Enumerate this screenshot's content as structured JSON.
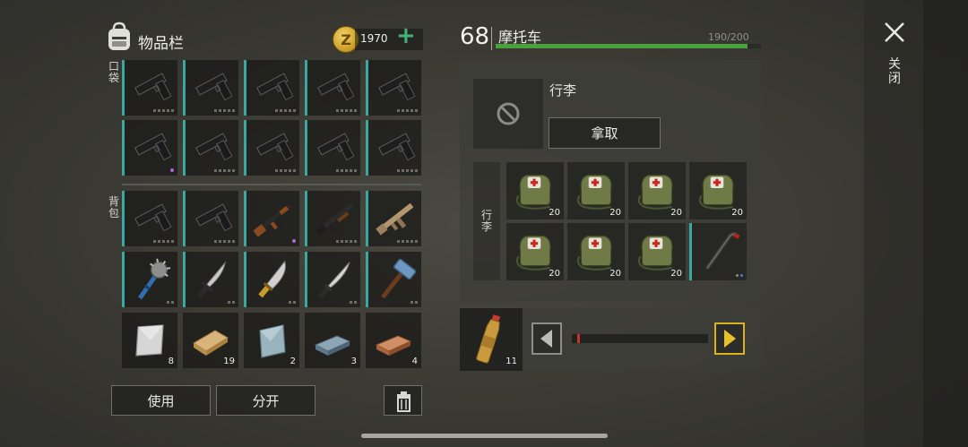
{
  "inventory": {
    "title": "物品栏",
    "coins": "1970",
    "coin_symbol": "Z",
    "pocket_label": "口袋",
    "backpack_label": "背包",
    "use_button": "使用",
    "split_button": "分开"
  },
  "pocket_slots": [
    {
      "item": "pistol-icon",
      "marker": "dots"
    },
    {
      "item": "pistol-icon",
      "marker": "dots"
    },
    {
      "item": "pistol-icon",
      "marker": "dots"
    },
    {
      "item": "pistol-icon",
      "marker": "dots"
    },
    {
      "item": "pistol-icon",
      "marker": "dots"
    },
    {
      "item": "pistol-icon",
      "marker": "purple"
    },
    {
      "item": "pistol-icon",
      "marker": "dots"
    },
    {
      "item": "pistol-icon",
      "marker": "dots"
    },
    {
      "item": "pistol-icon",
      "marker": "dots"
    },
    {
      "item": "pistol-icon",
      "marker": "dots"
    }
  ],
  "backpack_slots": [
    {
      "item": "pistol-icon",
      "marker": "dots"
    },
    {
      "item": "pistol-icon",
      "marker": "dots"
    },
    {
      "item": "assault-rifle-icon",
      "marker": "purple"
    },
    {
      "item": "shotgun-icon",
      "marker": "dots"
    },
    {
      "item": "tan-rifle-icon",
      "marker": "dots"
    },
    {
      "item": "spiked-mace-icon",
      "marker": "dots"
    },
    {
      "item": "sword-icon",
      "marker": "dots"
    },
    {
      "item": "machete-icon",
      "marker": "dots"
    },
    {
      "item": "katana-icon",
      "marker": "dots"
    },
    {
      "item": "sledgehammer-icon",
      "marker": "dots"
    },
    {
      "item": "metal-plate-icon",
      "qty": "8"
    },
    {
      "item": "wood-plank-icon",
      "qty": "19"
    },
    {
      "item": "glass-sheet-icon",
      "qty": "2"
    },
    {
      "item": "steel-ingot-icon",
      "qty": "3"
    },
    {
      "item": "copper-ingot-icon",
      "qty": "4"
    }
  ],
  "vehicle": {
    "level": "68",
    "name": "摩托车",
    "hp_text": "190/200",
    "hp_fraction": 0.95,
    "luggage_title": "行李",
    "take_button": "拿取",
    "luggage_side_label": "行李"
  },
  "luggage_slots": [
    {
      "item": "medkit-bag-icon",
      "qty": "20"
    },
    {
      "item": "medkit-bag-icon",
      "qty": "20"
    },
    {
      "item": "medkit-bag-icon",
      "qty": "20"
    },
    {
      "item": "medkit-bag-icon",
      "qty": "20"
    },
    {
      "item": "medkit-bag-icon",
      "qty": "20"
    },
    {
      "item": "medkit-bag-icon",
      "qty": "20"
    },
    {
      "item": "medkit-bag-icon",
      "qty": "20"
    },
    {
      "item": "crowbar-icon",
      "marker": "blue-dots"
    }
  ],
  "fuel": {
    "bottle_qty": "11",
    "slider_fraction": 0.04
  },
  "close_label": "关闭",
  "colors": {
    "accent_teal": "#3aa8a1",
    "hp_green": "#47a23b",
    "coin_plus": "#44b07a",
    "arrow_yellow": "#d9b21c"
  }
}
